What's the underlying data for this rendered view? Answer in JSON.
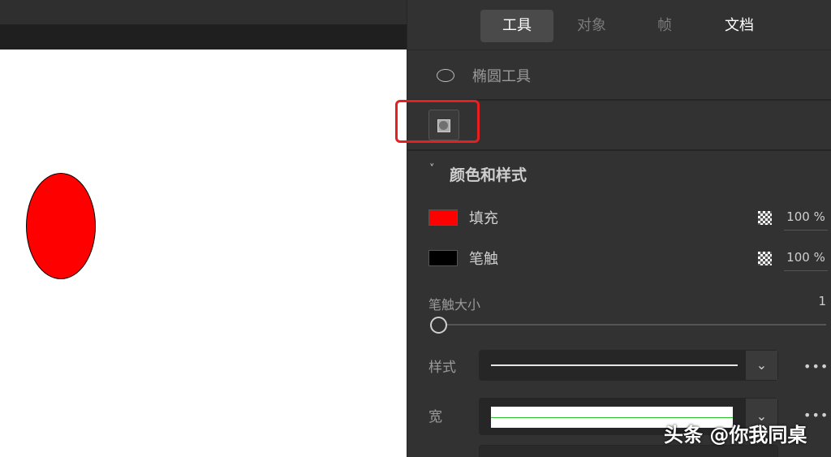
{
  "tabs": [
    {
      "label": "工具",
      "active": true
    },
    {
      "label": "对象",
      "active": false
    },
    {
      "label": "帧",
      "active": false
    },
    {
      "label": "文档",
      "active": false
    }
  ],
  "tool": {
    "icon": "ellipse-icon",
    "label": "椭圆工具"
  },
  "object_drawing_mode": {
    "icon": "object-drawing-icon"
  },
  "section": {
    "title": "颜色和样式",
    "icon": "chevron-down-icon"
  },
  "fill": {
    "label": "填充",
    "color": "#ff0000",
    "opacity": "100 %"
  },
  "stroke": {
    "label": "笔触",
    "color": "#000000",
    "opacity": "100 %"
  },
  "stroke_size": {
    "label": "笔触大小",
    "value": "1",
    "level": 0.0
  },
  "style": {
    "label": "样式"
  },
  "width": {
    "label": "宽"
  },
  "canvas": {
    "background": "#ffffff",
    "shape": {
      "type": "ellipse",
      "fill": "#ff0000",
      "stroke": "#000000"
    }
  },
  "watermark": "头条 @你我同桌",
  "accent": {
    "highlight": "#e62020",
    "width_line": "#29c529"
  }
}
